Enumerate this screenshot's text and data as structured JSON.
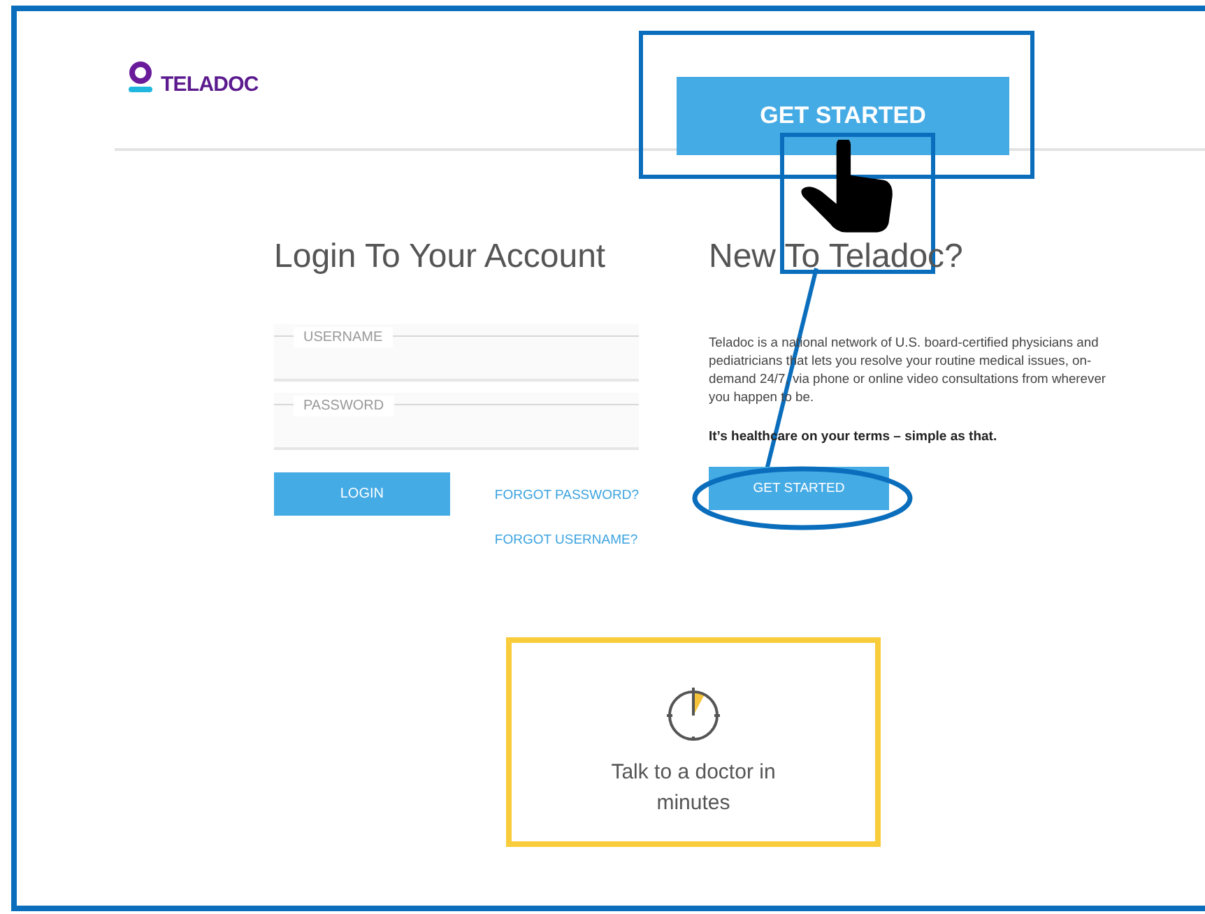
{
  "header": {
    "logo_text": "TELADOC",
    "cta": "GET STARTED"
  },
  "login": {
    "title": "Login To Your Account",
    "fields": [
      {
        "label": "USERNAME"
      },
      {
        "label": "PASSWORD"
      }
    ],
    "button": "LOGIN",
    "links": [
      "FORGOT PASSWORD?",
      "FORGOT USERNAME?"
    ]
  },
  "signup": {
    "title": "New To Teladoc?",
    "description": "Teladoc is a national network of U.S. board-certified physicians and pediatricians that lets you resolve your routine medical issues, on-demand 24/7, via phone or online video consultations from wherever you happen to be.",
    "tagline": "It’s healthcare on your terms – simple as that.",
    "button": "GET STARTED"
  },
  "feature": {
    "text": "Talk to a doctor in minutes"
  }
}
